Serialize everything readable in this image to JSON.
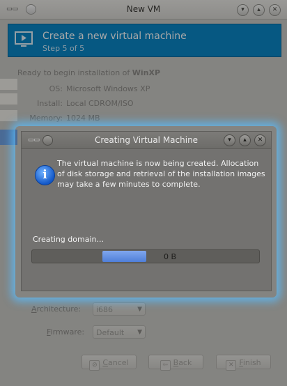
{
  "window": {
    "title": "New VM",
    "banner_title": "Create a new virtual machine",
    "banner_subtitle": "Step 5 of 5"
  },
  "summary": {
    "heading_prefix": "Ready to begin installation of",
    "vm_name": "WinXP",
    "rows": [
      {
        "label": "OS:",
        "value": "Microsoft Windows XP"
      },
      {
        "label": "Install:",
        "value": "Local CDROM/ISO"
      },
      {
        "label": "Memory:",
        "value": "1024 MB"
      }
    ]
  },
  "advanced": {
    "architecture_label_underline": "A",
    "architecture_label_rest": "rchitecture:",
    "architecture_value": "i686",
    "firmware_label_underline": "F",
    "firmware_label_rest": "irmware:",
    "firmware_value": "Default"
  },
  "buttons": {
    "cancel_underline": "C",
    "cancel_rest": "ancel",
    "back_underline": "B",
    "back_rest": "ack",
    "finish_underline": "F",
    "finish_rest": "inish"
  },
  "dialog": {
    "title": "Creating Virtual Machine",
    "message": "The virtual machine is now being created. Allocation of disk storage and retrieval of the installation images may take a few minutes to complete.",
    "status": "Creating domain...",
    "progress_text": "0 B"
  },
  "colors": {
    "accent": "#0a86c6",
    "progress": "#5a88dc",
    "glow": "#5abeff"
  }
}
